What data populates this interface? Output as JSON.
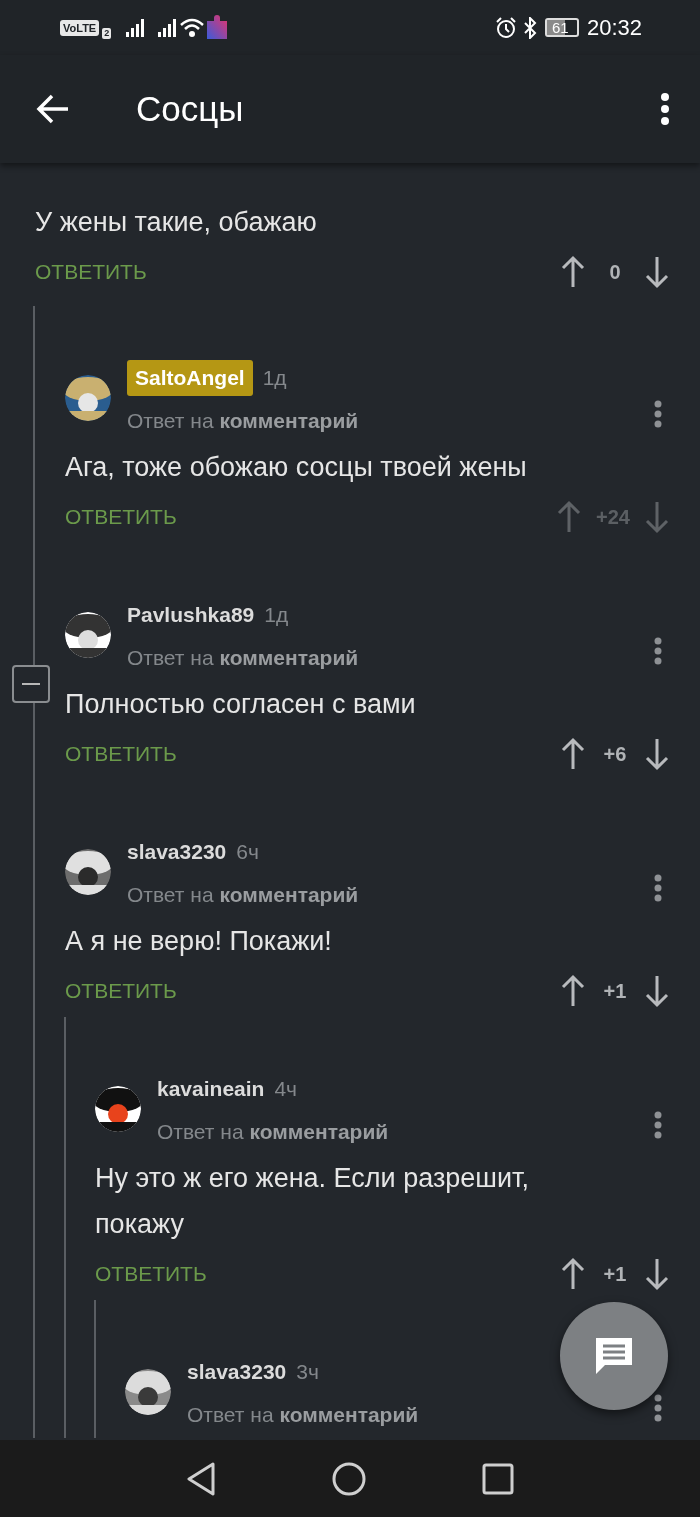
{
  "status_bar": {
    "volte": "VoLTE",
    "sim": "2",
    "battery": "61",
    "time": "20:32"
  },
  "app_bar": {
    "title": "Сосцы"
  },
  "comments": [
    {
      "text": "У жены такие, обажаю",
      "reply": "ОТВЕТИТЬ",
      "score": "0",
      "dimmed": false,
      "children": [
        {
          "author": "SaltoAngel",
          "highlighted": true,
          "time": "1д",
          "reply_to": "Ответ на **комментарий**",
          "text": "Ага, тоже обожаю сосцы твоей жены",
          "reply": "ОТВЕТИТЬ",
          "score": "+24",
          "dimmed": true,
          "collapse": false
        },
        {
          "author": "Pavlushka89",
          "highlighted": false,
          "time": "1д",
          "reply_to": "Ответ на **комментарий**",
          "text": "Полностью согласен с вами",
          "reply": "ОТВЕТИТЬ",
          "score": "+6",
          "dimmed": false,
          "collapse": true
        },
        {
          "author": "slava3230",
          "highlighted": false,
          "time": "6ч",
          "reply_to": "Ответ на **комментарий**",
          "text": "А я не верю! Покажи!",
          "reply": "ОТВЕТИТЬ",
          "score": "+1",
          "dimmed": false,
          "collapse": false,
          "children": [
            {
              "author": "kavaineain",
              "highlighted": false,
              "time": "4ч",
              "reply_to": "Ответ на **комментарий**",
              "text": "Ну это ж его жена. Если разрешит, покажу",
              "reply": "ОТВЕТИТЬ",
              "score": "+1",
              "dimmed": false,
              "collapse": false,
              "children": [
                {
                  "author": "slava3230",
                  "highlighted": false,
                  "time": "3ч",
                  "reply_to": "Ответ на **комментарий**",
                  "collapse": false
                }
              ]
            }
          ]
        }
      ]
    }
  ]
}
